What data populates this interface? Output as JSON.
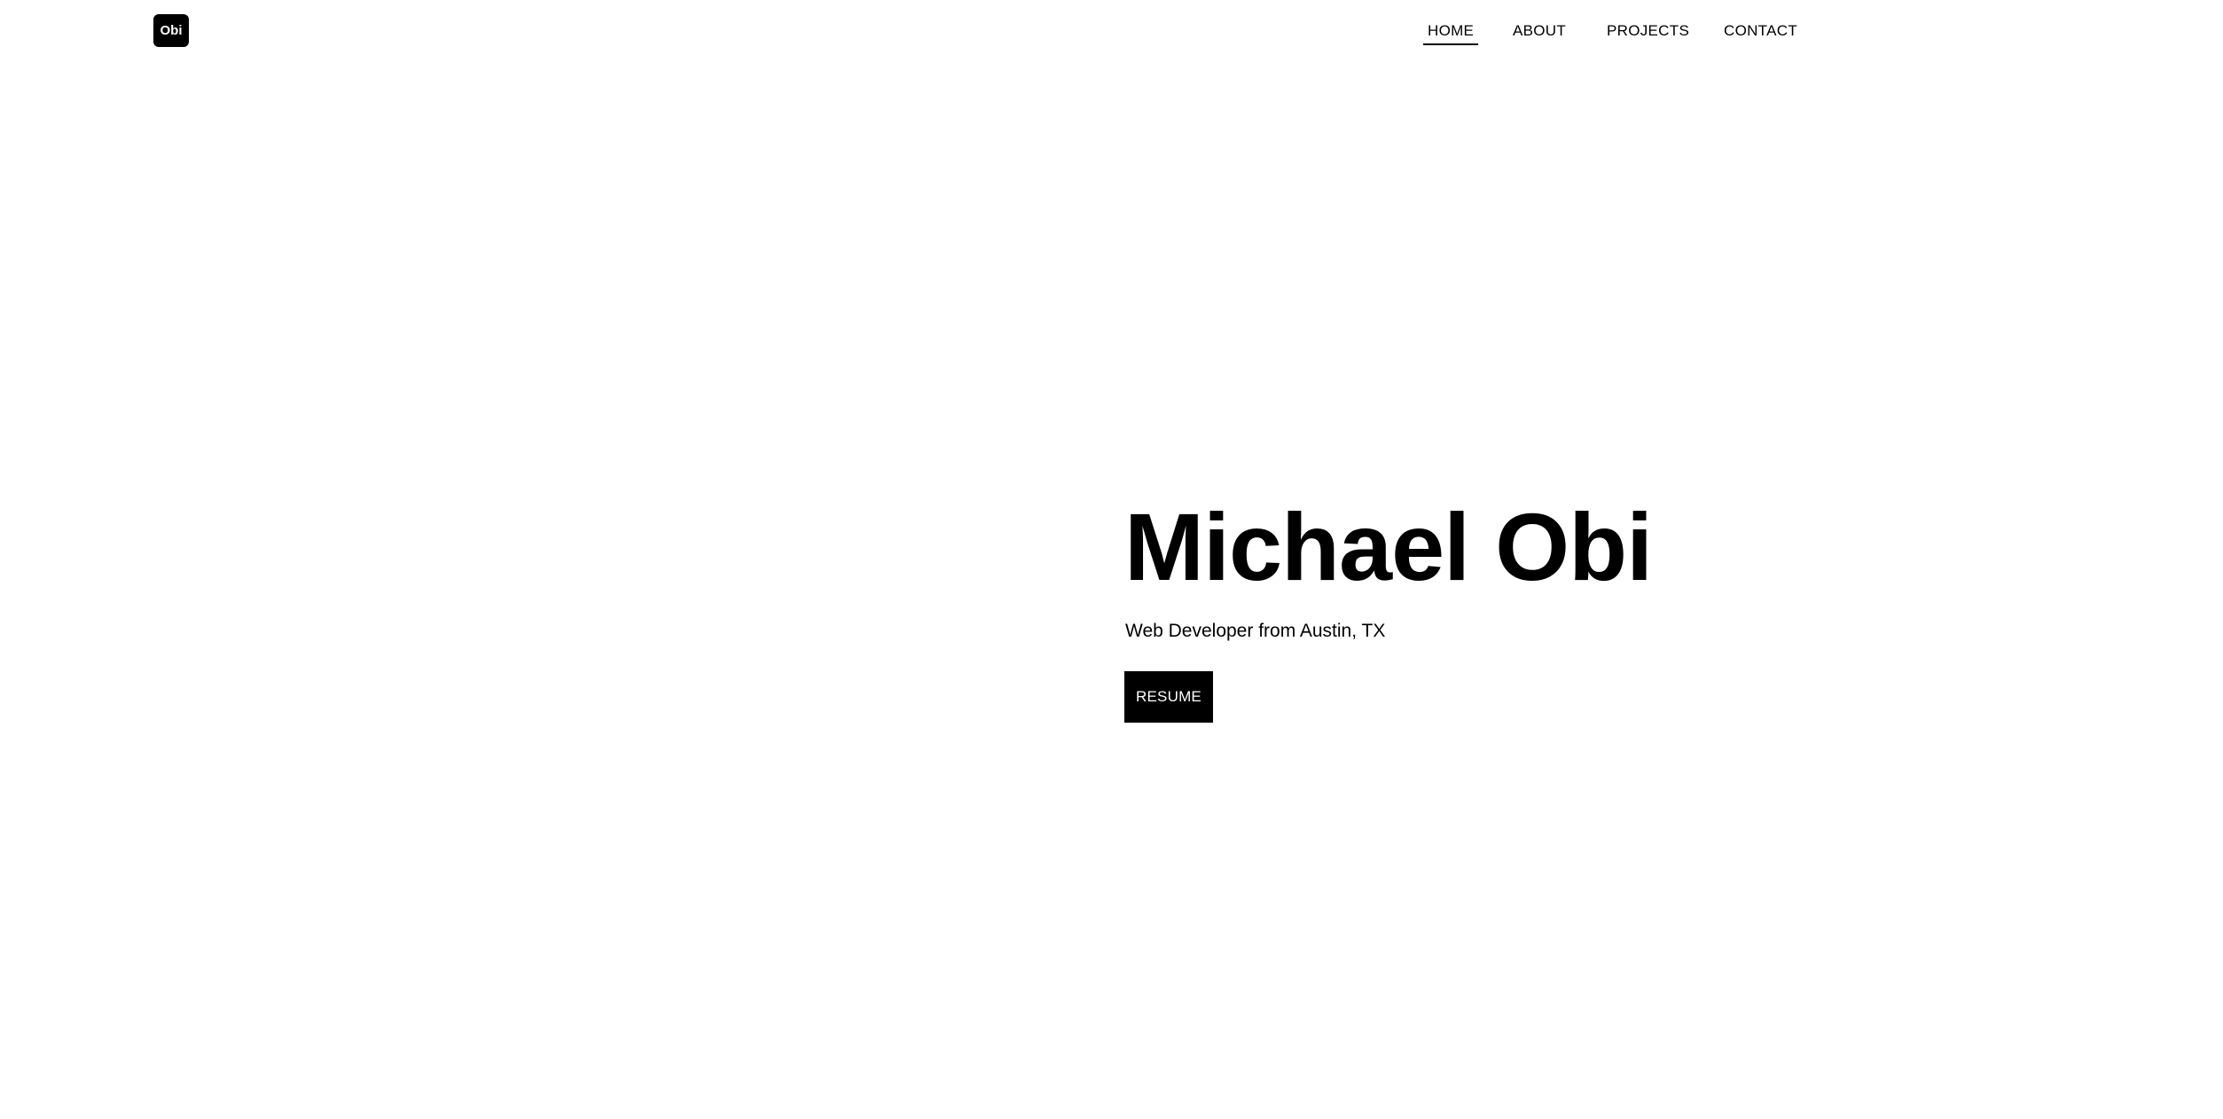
{
  "header": {
    "logo_text": "Obi",
    "nav": {
      "home": "HOME",
      "about": "ABOUT",
      "projects": "PROJECTS",
      "contact": "CONTACT",
      "active": "HOME"
    }
  },
  "hero": {
    "name": "Michael Obi",
    "subtitle": "Web Developer from Austin, TX",
    "resume_button": "RESUME"
  },
  "colors": {
    "background": "#ffffff",
    "text": "#000000",
    "button_background": "#000000",
    "button_text": "#ffffff"
  }
}
